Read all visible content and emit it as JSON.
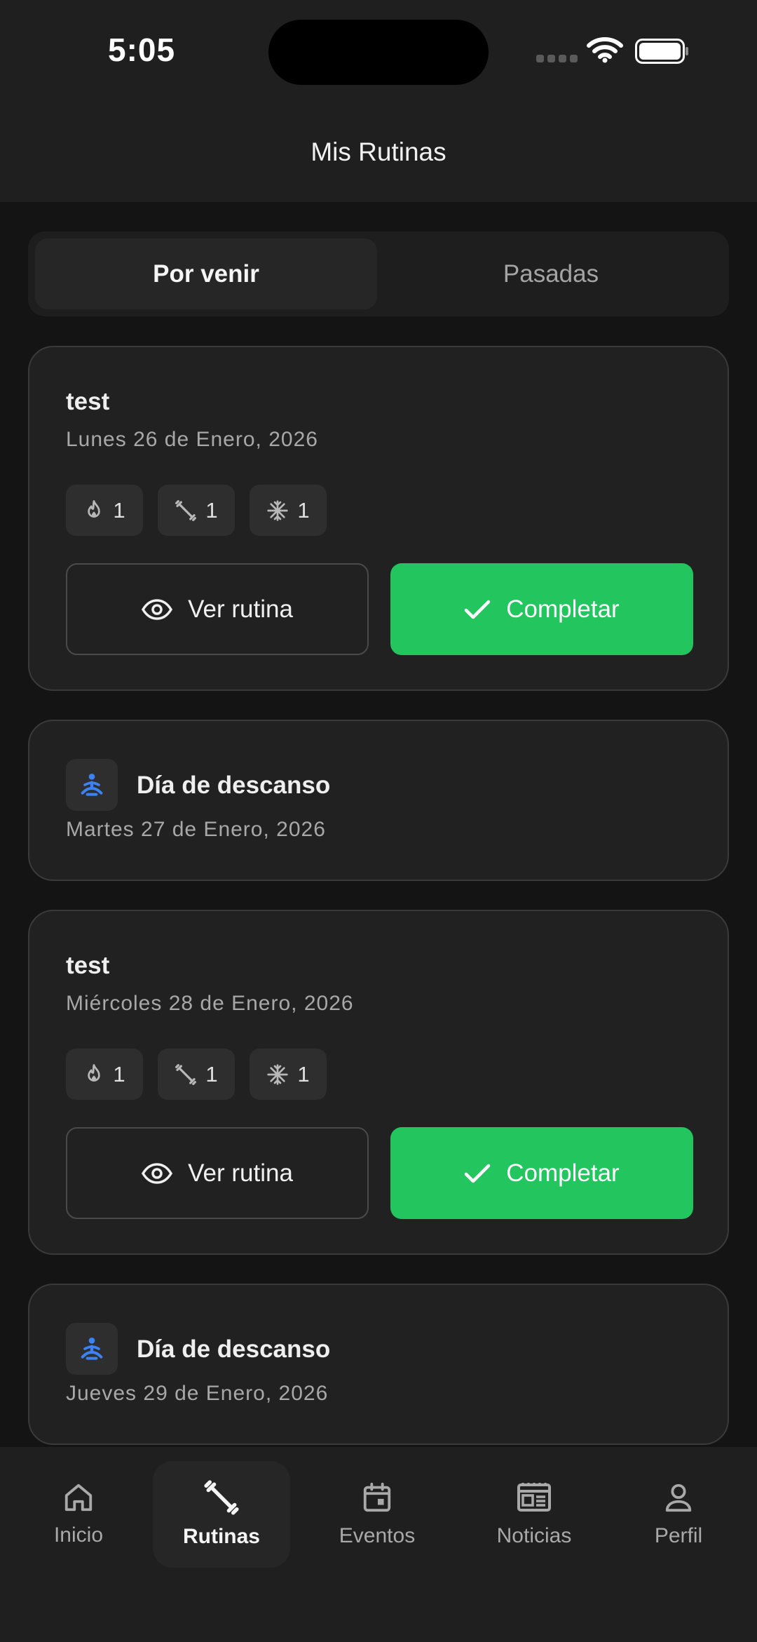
{
  "status_bar": {
    "time": "5:05"
  },
  "header": {
    "title": "Mis Rutinas"
  },
  "tabs": [
    {
      "label": "Por venir",
      "active": true
    },
    {
      "label": "Pasadas",
      "active": false
    }
  ],
  "cards": [
    {
      "type": "routine",
      "title": "test",
      "date": "Lunes 26 de Enero, 2026",
      "chips": [
        {
          "icon": "flame-icon",
          "value": "1"
        },
        {
          "icon": "dumbbell-icon",
          "value": "1"
        },
        {
          "icon": "snowflake-icon",
          "value": "1"
        }
      ],
      "view_label": "Ver rutina",
      "complete_label": "Completar"
    },
    {
      "type": "rest",
      "icon": "meditation-icon",
      "title": "Día de descanso",
      "date": "Martes 27 de Enero, 2026"
    },
    {
      "type": "routine",
      "title": "test",
      "date": "Miércoles 28 de Enero, 2026",
      "chips": [
        {
          "icon": "flame-icon",
          "value": "1"
        },
        {
          "icon": "dumbbell-icon",
          "value": "1"
        },
        {
          "icon": "snowflake-icon",
          "value": "1"
        }
      ],
      "view_label": "Ver rutina",
      "complete_label": "Completar"
    },
    {
      "type": "rest",
      "icon": "meditation-icon",
      "title": "Día de descanso",
      "date": "Jueves 29 de Enero, 2026"
    }
  ],
  "bottom_nav": [
    {
      "label": "Inicio",
      "icon": "home-icon",
      "active": false
    },
    {
      "label": "Rutinas",
      "icon": "dumbbell-icon",
      "active": true
    },
    {
      "label": "Eventos",
      "icon": "calendar-icon",
      "active": false
    },
    {
      "label": "Noticias",
      "icon": "newspaper-icon",
      "active": false
    },
    {
      "label": "Perfil",
      "icon": "user-icon",
      "active": false
    }
  ],
  "colors": {
    "accent_green": "#22c55e",
    "rest_icon_blue": "#3b82f6",
    "background": "#141414",
    "card": "#212121"
  }
}
